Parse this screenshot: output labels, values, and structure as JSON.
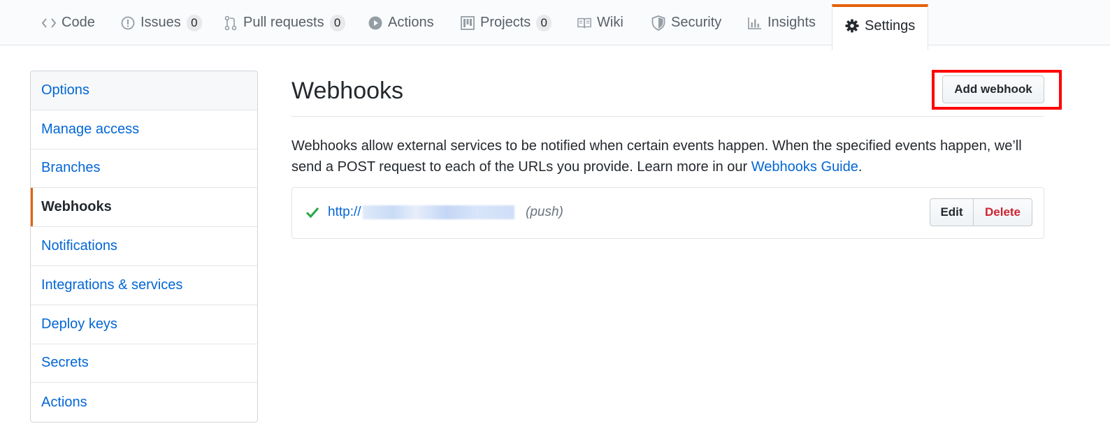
{
  "repo_nav": {
    "tabs": [
      {
        "label": "Code",
        "icon": "code-icon",
        "counter": null
      },
      {
        "label": "Issues",
        "icon": "issue-icon",
        "counter": "0"
      },
      {
        "label": "Pull requests",
        "icon": "pull-request-icon",
        "counter": "0"
      },
      {
        "label": "Actions",
        "icon": "play-icon",
        "counter": null
      },
      {
        "label": "Projects",
        "icon": "project-icon",
        "counter": "0"
      },
      {
        "label": "Wiki",
        "icon": "book-icon",
        "counter": null
      },
      {
        "label": "Security",
        "icon": "shield-icon",
        "counter": null
      },
      {
        "label": "Insights",
        "icon": "graph-icon",
        "counter": null
      },
      {
        "label": "Settings",
        "icon": "gear-icon",
        "counter": null,
        "selected": true
      }
    ]
  },
  "sidebar": {
    "items": [
      {
        "label": "Options"
      },
      {
        "label": "Manage access"
      },
      {
        "label": "Branches"
      },
      {
        "label": "Webhooks",
        "selected": true
      },
      {
        "label": "Notifications"
      },
      {
        "label": "Integrations & services"
      },
      {
        "label": "Deploy keys"
      },
      {
        "label": "Secrets"
      },
      {
        "label": "Actions"
      }
    ]
  },
  "main": {
    "title": "Webhooks",
    "add_button_label": "Add webhook",
    "description_text": "Webhooks allow external services to be notified when certain events happen. When the specified events happen, we’ll send a POST request to each of the URLs you provide. Learn more in our ",
    "guide_link_label": "Webhooks Guide",
    "description_end": ".",
    "hooks": [
      {
        "status_icon": "check-icon",
        "url_prefix": "http://",
        "events": "(push)",
        "edit_label": "Edit",
        "delete_label": "Delete"
      }
    ]
  },
  "colors": {
    "accent_orange": "#e36209",
    "link_blue": "#0366d6",
    "success_green": "#28a745",
    "danger_red": "#cb2431",
    "highlight_red": "#ff0000"
  }
}
